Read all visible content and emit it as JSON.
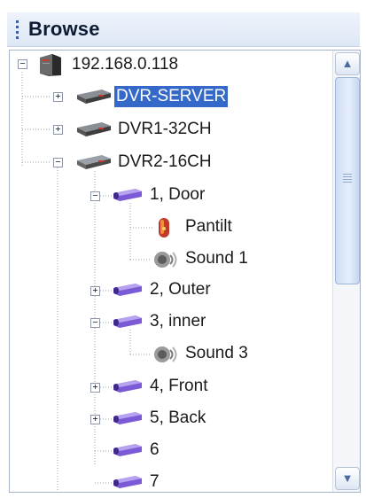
{
  "panel": {
    "title": "Browse"
  },
  "tree": {
    "root": {
      "label": "192.168.0.118",
      "icon": "server-tower-icon",
      "expanded": true
    },
    "servers": [
      {
        "label": "DVR-SERVER",
        "icon": "dvr-device-icon",
        "expanded": false,
        "selected": true
      },
      {
        "label": "DVR1-32CH",
        "icon": "dvr-device-icon",
        "expanded": false,
        "selected": false
      },
      {
        "label": "DVR2-16CH",
        "icon": "dvr-device-icon",
        "expanded": true,
        "selected": false
      }
    ],
    "cameras": [
      {
        "label": "1, Door",
        "icon": "camera-icon",
        "expander": "minus"
      },
      {
        "label": "Pantilt",
        "icon": "pantilt-icon",
        "expander": null
      },
      {
        "label": "Sound 1",
        "icon": "speaker-sound-icon",
        "expander": null
      },
      {
        "label": "2, Outer",
        "icon": "camera-icon",
        "expander": "plus"
      },
      {
        "label": "3, inner",
        "icon": "camera-icon",
        "expander": "minus"
      },
      {
        "label": "Sound 3",
        "icon": "speaker-sound-icon",
        "expander": null
      },
      {
        "label": "4, Front",
        "icon": "camera-icon",
        "expander": "plus"
      },
      {
        "label": "5, Back",
        "icon": "camera-icon",
        "expander": "plus"
      },
      {
        "label": "6",
        "icon": "camera-icon",
        "expander": null
      },
      {
        "label": "7",
        "icon": "camera-icon",
        "expander": null
      }
    ]
  },
  "colors": {
    "selection": "#3569c9",
    "header_text": "#0e1a33",
    "camera": "#7b5ad6"
  }
}
